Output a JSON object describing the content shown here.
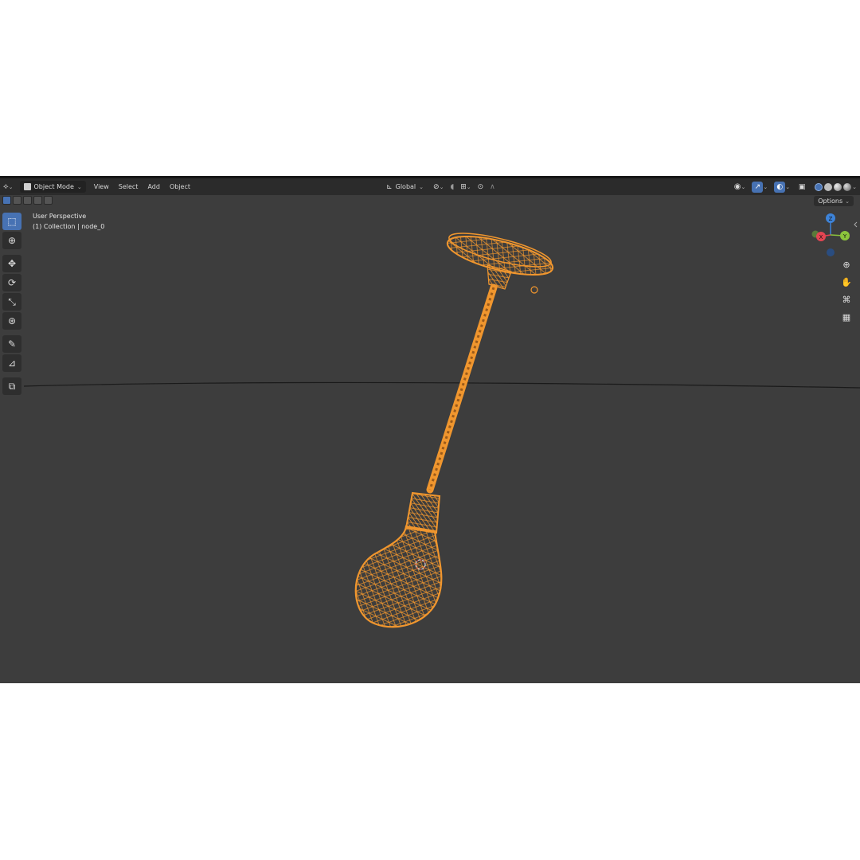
{
  "header": {
    "mode_label": "Object Mode",
    "menus": [
      "View",
      "Select",
      "Add",
      "Object"
    ],
    "orientation_label": "Global",
    "options_label": "Options"
  },
  "viewport": {
    "view_name": "User Perspective",
    "collection_info": "(1) Collection | node_0"
  },
  "gizmo": {
    "z": "Z",
    "y": "Y",
    "x": "X"
  },
  "colors": {
    "viewport_bg": "#3d3d3d",
    "header_bg": "#2b2b2b",
    "active_blue": "#4772b3",
    "wireframe_orange": "#f0962e",
    "axis_x": "#e34552",
    "axis_y": "#8bc43c",
    "axis_z": "#3d83d9"
  },
  "icons": {
    "editor_type": "axes-icon",
    "mode": "object-icon",
    "transform_orientation": "orientation-icon",
    "pivot": "pivot-icon",
    "snap": "magnet-icon",
    "proportional": "proportional-icon",
    "visibility": "eye-icon",
    "gizmos": "gizmo-icon",
    "overlays": "overlay-icon",
    "xray": "xray-icon",
    "shading": "shading-icon"
  }
}
